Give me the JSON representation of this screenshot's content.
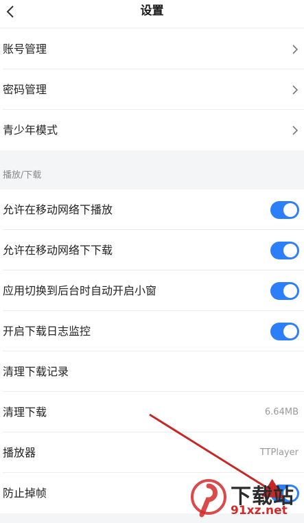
{
  "header": {
    "title": "设置",
    "back_icon": "chevron-left-icon"
  },
  "account_group": {
    "items": [
      {
        "label": "账号管理"
      },
      {
        "label": "密码管理"
      },
      {
        "label": "青少年模式"
      }
    ]
  },
  "playback_section": {
    "title": "播放/下载",
    "items": [
      {
        "label": "允许在移动网络下播放",
        "toggle_on": true
      },
      {
        "label": "允许在移动网络下下载",
        "toggle_on": true
      },
      {
        "label": "应用切换到后台时自动开启小窗",
        "toggle_on": true
      },
      {
        "label": "开启下载日志监控",
        "toggle_on": true
      },
      {
        "label": "清理下载记录"
      },
      {
        "label": "清理下载",
        "value": "6.64MB"
      },
      {
        "label": "播放器",
        "value": "TTPlayer"
      },
      {
        "label": "防止掉帧"
      }
    ]
  },
  "colors": {
    "toggle_on": "#2d7ff9",
    "annotation_arrow": "#c62828",
    "watermark_red": "#d42a2a"
  },
  "watermark": {
    "cn": "下载站",
    "url": "91xz.net"
  }
}
